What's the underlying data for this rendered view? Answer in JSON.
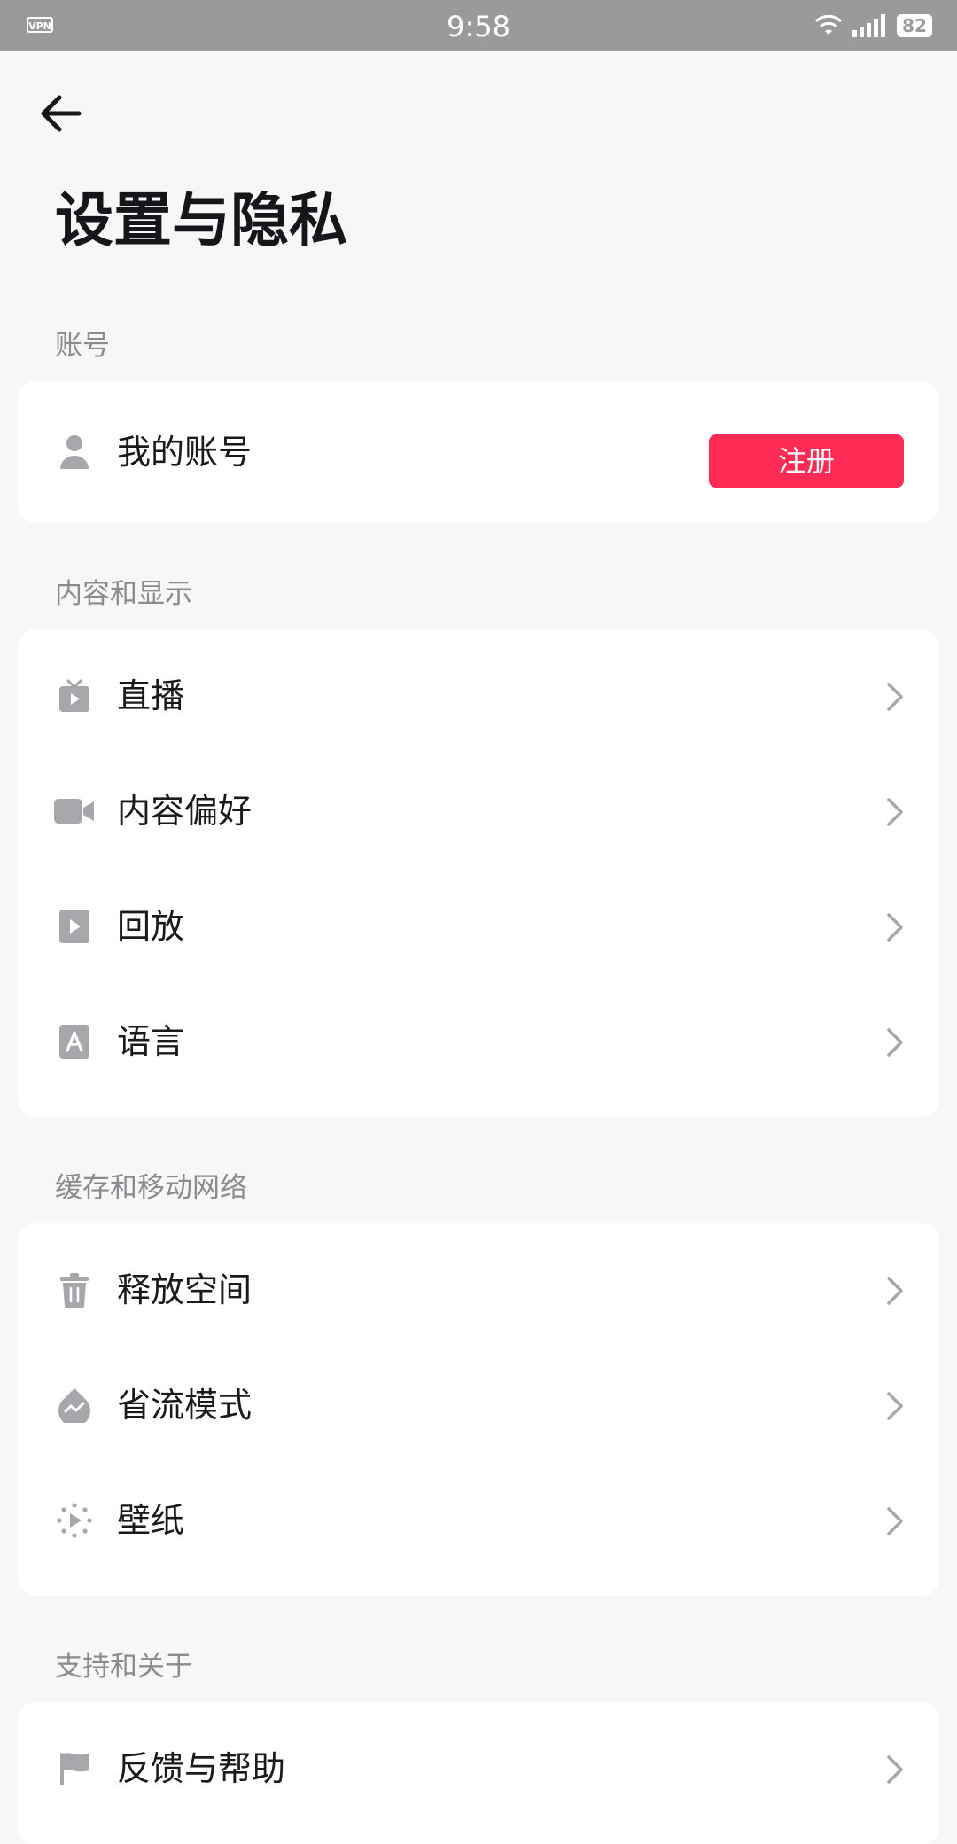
{
  "status_bar": {
    "vpn": "VPN",
    "time": "9:58",
    "battery": "82"
  },
  "header": {
    "title": "设置与隐私"
  },
  "sections": [
    {
      "label": "账号",
      "items": [
        {
          "label": "我的账号",
          "icon": "person-icon",
          "action_label": "注册"
        }
      ]
    },
    {
      "label": "内容和显示",
      "items": [
        {
          "label": "直播",
          "icon": "tv-icon"
        },
        {
          "label": "内容偏好",
          "icon": "video-camera-icon"
        },
        {
          "label": "回放",
          "icon": "play-square-icon"
        },
        {
          "label": "语言",
          "icon": "language-a-icon"
        }
      ]
    },
    {
      "label": "缓存和移动网络",
      "items": [
        {
          "label": "释放空间",
          "icon": "trash-icon"
        },
        {
          "label": "省流模式",
          "icon": "data-saver-drop-icon"
        },
        {
          "label": "壁纸",
          "icon": "wallpaper-play-icon"
        }
      ]
    },
    {
      "label": "支持和关于",
      "items": [
        {
          "label": "反馈与帮助",
          "icon": "flag-icon"
        }
      ]
    }
  ],
  "colors": {
    "accent": "#fe2c55",
    "icon_gray": "#a6a6ab",
    "background": "#f7f7f7"
  }
}
